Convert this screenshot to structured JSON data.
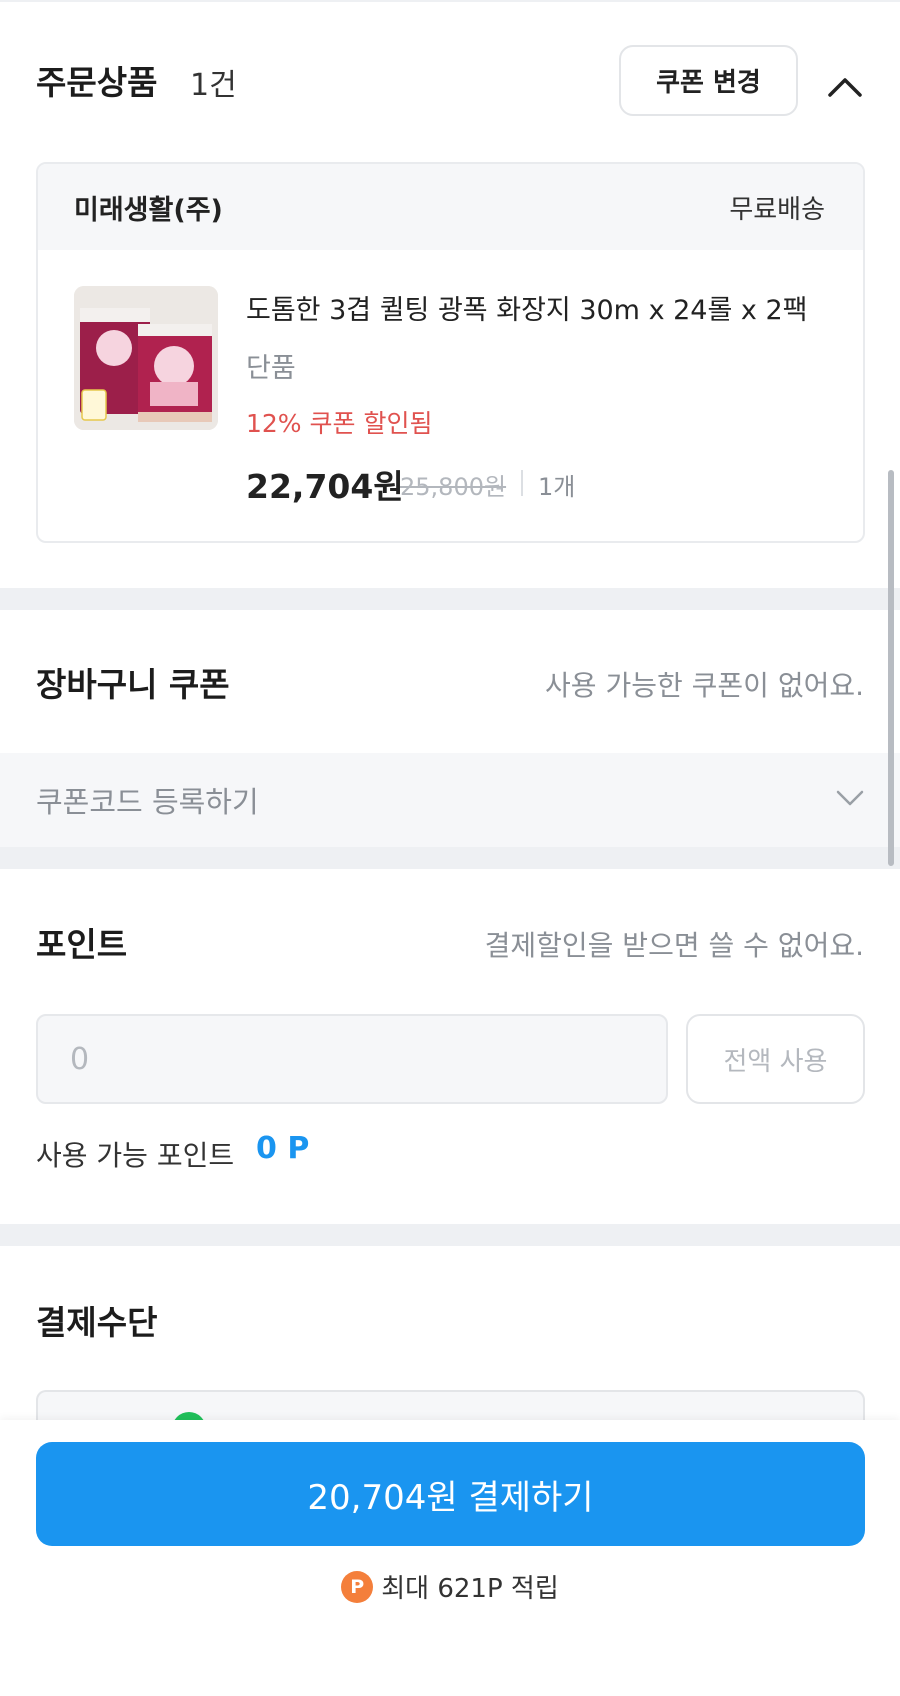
{
  "order": {
    "title": "주문상품",
    "count": "1건",
    "coupon_change_label": "쿠폰 변경",
    "seller": {
      "name": "미래생활(주)",
      "shipping": "무료배송"
    },
    "product": {
      "thumbnail_icon": "toilet-paper-package-image",
      "name": "도톰한 3겹 퀼팅 광폭 화장지 30m x 24롤 x 2팩",
      "option": "단품",
      "discount_text": "12% 쿠폰 할인됨",
      "price": "22,704원",
      "original_price": "25,800원",
      "quantity": "1개"
    }
  },
  "cart_coupon": {
    "title": "장바구니 쿠폰",
    "message": "사용 가능한 쿠폰이 없어요.",
    "code_label": "쿠폰코드 등록하기"
  },
  "points": {
    "title": "포인트",
    "message": "결제할인을 받으면 쓸 수 없어요.",
    "input_placeholder": "0",
    "use_all_label": "전액 사용",
    "available_label": "사용 가능 포인트",
    "available_value": "0 P"
  },
  "payment": {
    "title": "결제수단"
  },
  "checkout": {
    "pay_button_label": "20,704원 결제하기",
    "reward_icon_letter": "P",
    "reward_text": "최대 621P 적립"
  },
  "colors": {
    "accent": "#1a95f0",
    "discount": "#e0524f",
    "reward": "#f47f3b"
  }
}
